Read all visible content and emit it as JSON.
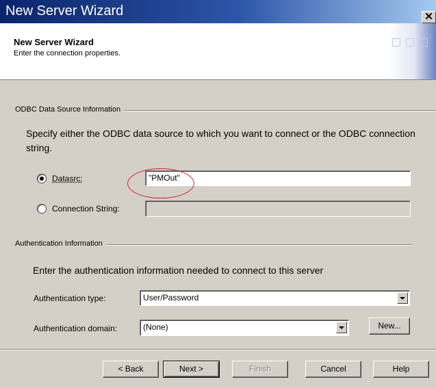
{
  "window": {
    "title": "New Server Wizard",
    "close_glyph": "✕"
  },
  "header": {
    "title": "New Server Wizard",
    "subtitle": "Enter the connection properties."
  },
  "odbc_section": {
    "heading": "ODBC Data Source Information",
    "description": "Specify either the ODBC data source to which you want to connect or the ODBC connection string.",
    "datasrc": {
      "label": "Datasrc:",
      "value": "\"PMOut\"",
      "selected": true
    },
    "connection_string": {
      "label": "Connection String:",
      "value": "",
      "selected": false
    }
  },
  "auth_section": {
    "heading": "Authentication Information",
    "description": "Enter the authentication information needed to connect to this server",
    "auth_type": {
      "label": "Authentication type:",
      "value": "User/Password"
    },
    "auth_domain": {
      "label": "Authentication domain:",
      "value": "(None)"
    },
    "new_button": "New..."
  },
  "buttons": {
    "back": "< Back",
    "next": "Next >",
    "finish": "Finish",
    "cancel": "Cancel",
    "help": "Help"
  },
  "colors": {
    "titlebar_start": "#0a246a",
    "titlebar_end": "#a6caf0",
    "face": "#d4d0c8",
    "highlight_circle": "#d02020"
  }
}
